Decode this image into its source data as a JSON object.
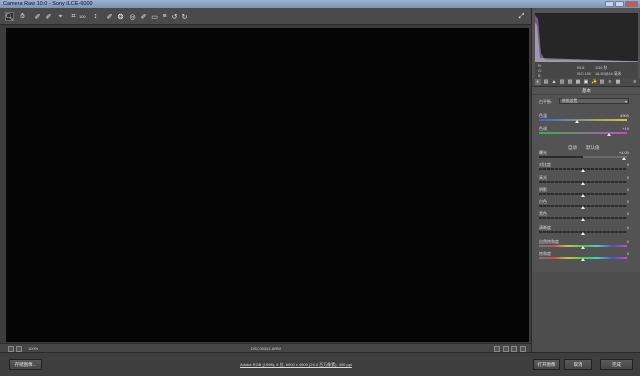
{
  "window": {
    "title": "Camera Raw 10.0 - Sony ILCE-6000"
  },
  "toolbar": {
    "tools": [
      "zoom-tool",
      "hand-tool",
      "white-balance-tool",
      "color-sampler-tool",
      "targeted-adjustment-tool",
      "crop-tool",
      "straighten-tool",
      "transform-tool",
      "spot-removal-tool",
      "red-eye-tool",
      "adjustment-brush-tool",
      "graduated-filter-tool",
      "radial-filter-tool",
      "preferences-tool",
      "rotate-ccw-tool",
      "rotate-cw-tool"
    ],
    "zoom_label": "100"
  },
  "histogram": {
    "values_rgb": [
      "R:",
      "G:",
      "B:"
    ]
  },
  "exif": {
    "aperture": "f/5.6",
    "shutter": "1/30 秒",
    "iso": "ISO 100",
    "focal": "16-50@16 毫米"
  },
  "panel": {
    "section_title": "基本",
    "white_balance_label": "白平衡:",
    "white_balance_value": "原照设置",
    "auto_label": "自动",
    "default_label": "默认值",
    "sliders": [
      {
        "name": "色温",
        "value": "4900",
        "pos": 0.43
      },
      {
        "name": "色调",
        "value": "+19",
        "pos": 0.8
      },
      {
        "name": "曝光",
        "value": "+4.00",
        "pos": 0.97
      },
      {
        "name": "对比度",
        "value": "0",
        "pos": 0.5
      },
      {
        "name": "高光",
        "value": "0",
        "pos": 0.5
      },
      {
        "name": "阴影",
        "value": "0",
        "pos": 0.5
      },
      {
        "name": "白色",
        "value": "0",
        "pos": 0.5
      },
      {
        "name": "黑色",
        "value": "0",
        "pos": 0.5
      },
      {
        "name": "清晰度",
        "value": "0",
        "pos": 0.5
      },
      {
        "name": "自然饱和度",
        "value": "0",
        "pos": 0.5
      },
      {
        "name": "饱和度",
        "value": "0",
        "pos": 0.5
      }
    ]
  },
  "bottombar": {
    "zoom": "100%",
    "filename": "DSC00341.ARW"
  },
  "footer": {
    "save_label": "存储图像...",
    "info_link": "Adobe RGB (1998); 8 位; 6000 x 4000 (24.0 百万像素); 300 ppi",
    "open_label": "打开图像",
    "cancel_label": "取消",
    "done_label": "完成"
  },
  "colors": {
    "accent": "#6a6a6a",
    "image_bg": "#050505"
  }
}
